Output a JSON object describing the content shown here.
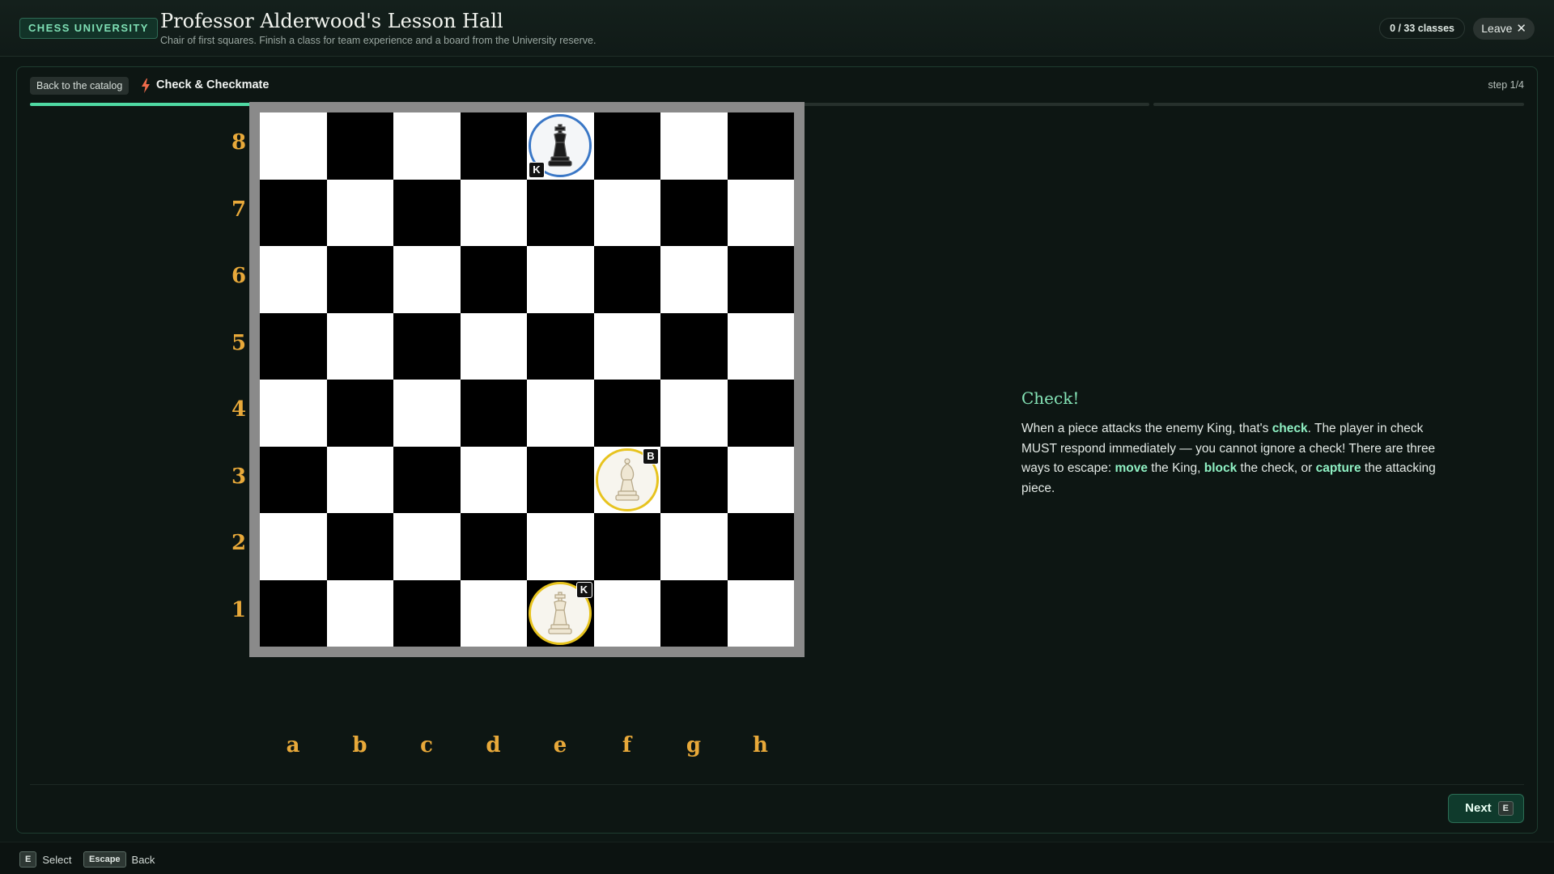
{
  "header": {
    "brand": "CHESS UNIVERSITY",
    "title": "Professor Alderwood's Lesson Hall",
    "subtitle": "Chair of first squares. Finish a class for team experience and a board from the University reserve.",
    "progress": "0 / 33 classes",
    "leave_label": "Leave"
  },
  "lesson": {
    "back_label": "Back to the catalog",
    "title": "Check & Checkmate",
    "step_label": "step 1/4",
    "step_current": 1,
    "step_total": 4,
    "heading": "Check!",
    "body": {
      "p1": "When a piece attacks the enemy King, that's ",
      "k1": "check",
      "p2": ". The player in check MUST respond immediately — you cannot ignore a check! There are three ways to escape: ",
      "k2": "move",
      "p3": " the King, ",
      "k3": "block",
      "p4": " the check, or ",
      "k4": "capture",
      "p5": " the attacking piece."
    },
    "next_label": "Next",
    "next_key": "E"
  },
  "board": {
    "files": [
      "a",
      "b",
      "c",
      "d",
      "e",
      "f",
      "g",
      "h"
    ],
    "ranks": [
      "8",
      "7",
      "6",
      "5",
      "4",
      "3",
      "2",
      "1"
    ],
    "pieces": [
      {
        "square": "e8",
        "color": "black",
        "type": "king",
        "tag": "K"
      },
      {
        "square": "f3",
        "color": "white",
        "type": "bishop",
        "tag": "B"
      },
      {
        "square": "e1",
        "color": "white",
        "type": "king",
        "tag": "K"
      }
    ],
    "colors": {
      "light": "#ffffff",
      "dark": "#000000",
      "label": "#e8a93a"
    }
  },
  "hints": [
    {
      "key": "E",
      "label": "Select"
    },
    {
      "key": "Escape",
      "label": "Back"
    }
  ],
  "colors": {
    "accent": "#4fd9a3",
    "black_ring": "#3a77c6",
    "white_ring": "#e7c31e"
  }
}
